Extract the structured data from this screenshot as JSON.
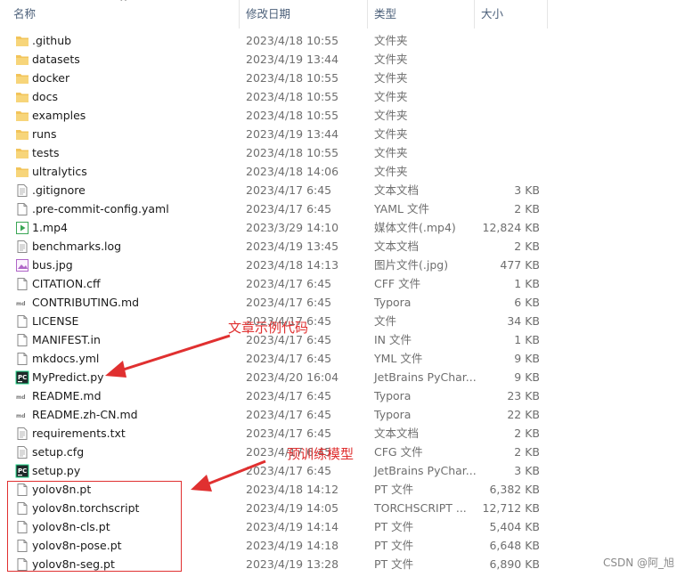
{
  "columns": {
    "name": "名称",
    "date": "修改日期",
    "type": "类型",
    "size": "大小"
  },
  "files": [
    {
      "name": ".github",
      "date": "2023/4/18 10:55",
      "type": "文件夹",
      "size": "",
      "icon": "folder-icon"
    },
    {
      "name": "datasets",
      "date": "2023/4/19 13:44",
      "type": "文件夹",
      "size": "",
      "icon": "folder-icon"
    },
    {
      "name": "docker",
      "date": "2023/4/18 10:55",
      "type": "文件夹",
      "size": "",
      "icon": "folder-icon"
    },
    {
      "name": "docs",
      "date": "2023/4/18 10:55",
      "type": "文件夹",
      "size": "",
      "icon": "folder-icon"
    },
    {
      "name": "examples",
      "date": "2023/4/18 10:55",
      "type": "文件夹",
      "size": "",
      "icon": "folder-icon"
    },
    {
      "name": "runs",
      "date": "2023/4/19 13:44",
      "type": "文件夹",
      "size": "",
      "icon": "folder-icon"
    },
    {
      "name": "tests",
      "date": "2023/4/18 10:55",
      "type": "文件夹",
      "size": "",
      "icon": "folder-icon"
    },
    {
      "name": "ultralytics",
      "date": "2023/4/18 14:06",
      "type": "文件夹",
      "size": "",
      "icon": "folder-icon"
    },
    {
      "name": ".gitignore",
      "date": "2023/4/17 6:45",
      "type": "文本文档",
      "size": "3 KB",
      "icon": "text-file-icon"
    },
    {
      "name": ".pre-commit-config.yaml",
      "date": "2023/4/17 6:45",
      "type": "YAML 文件",
      "size": "2 KB",
      "icon": "file-icon"
    },
    {
      "name": "1.mp4",
      "date": "2023/3/29 14:10",
      "type": "媒体文件(.mp4)",
      "size": "12,824 KB",
      "icon": "video-file-icon"
    },
    {
      "name": "benchmarks.log",
      "date": "2023/4/19 13:45",
      "type": "文本文档",
      "size": "2 KB",
      "icon": "text-file-icon"
    },
    {
      "name": "bus.jpg",
      "date": "2023/4/18 14:13",
      "type": "图片文件(.jpg)",
      "size": "477 KB",
      "icon": "image-file-icon"
    },
    {
      "name": "CITATION.cff",
      "date": "2023/4/17 6:45",
      "type": "CFF 文件",
      "size": "1 KB",
      "icon": "file-icon"
    },
    {
      "name": "CONTRIBUTING.md",
      "date": "2023/4/17 6:45",
      "type": "Typora",
      "size": "6 KB",
      "icon": "markdown-file-icon"
    },
    {
      "name": "LICENSE",
      "date": "2023/4/17 6:45",
      "type": "文件",
      "size": "34 KB",
      "icon": "file-icon"
    },
    {
      "name": "MANIFEST.in",
      "date": "2023/4/17 6:45",
      "type": "IN 文件",
      "size": "1 KB",
      "icon": "file-icon"
    },
    {
      "name": "mkdocs.yml",
      "date": "2023/4/17 6:45",
      "type": "YML 文件",
      "size": "9 KB",
      "icon": "file-icon"
    },
    {
      "name": "MyPredict.py",
      "date": "2023/4/20 16:04",
      "type": "JetBrains PyChar...",
      "size": "9 KB",
      "icon": "pycharm-file-icon"
    },
    {
      "name": "README.md",
      "date": "2023/4/17 6:45",
      "type": "Typora",
      "size": "23 KB",
      "icon": "markdown-file-icon"
    },
    {
      "name": "README.zh-CN.md",
      "date": "2023/4/17 6:45",
      "type": "Typora",
      "size": "22 KB",
      "icon": "markdown-file-icon"
    },
    {
      "name": "requirements.txt",
      "date": "2023/4/17 6:45",
      "type": "文本文档",
      "size": "2 KB",
      "icon": "text-file-icon"
    },
    {
      "name": "setup.cfg",
      "date": "2023/4/17 6:45",
      "type": "CFG 文件",
      "size": "2 KB",
      "icon": "text-file-icon"
    },
    {
      "name": "setup.py",
      "date": "2023/4/17 6:45",
      "type": "JetBrains PyChar...",
      "size": "3 KB",
      "icon": "pycharm-file-icon"
    },
    {
      "name": "yolov8n.pt",
      "date": "2023/4/18 14:12",
      "type": "PT 文件",
      "size": "6,382 KB",
      "icon": "file-icon"
    },
    {
      "name": "yolov8n.torchscript",
      "date": "2023/4/19 14:05",
      "type": "TORCHSCRIPT ...",
      "size": "12,712 KB",
      "icon": "file-icon"
    },
    {
      "name": "yolov8n-cls.pt",
      "date": "2023/4/19 14:14",
      "type": "PT 文件",
      "size": "5,404 KB",
      "icon": "file-icon"
    },
    {
      "name": "yolov8n-pose.pt",
      "date": "2023/4/19 14:18",
      "type": "PT 文件",
      "size": "6,648 KB",
      "icon": "file-icon"
    },
    {
      "name": "yolov8n-seg.pt",
      "date": "2023/4/19 13:28",
      "type": "PT 文件",
      "size": "6,890 KB",
      "icon": "file-icon"
    }
  ],
  "annotations": {
    "example_code": "文章示例代码",
    "pretrained_models": "预训练模型"
  },
  "watermark": "CSDN @阿_旭",
  "colors": {
    "annotation": "#e03030",
    "folder": "#f2c45a",
    "header_text": "#4c607a"
  }
}
